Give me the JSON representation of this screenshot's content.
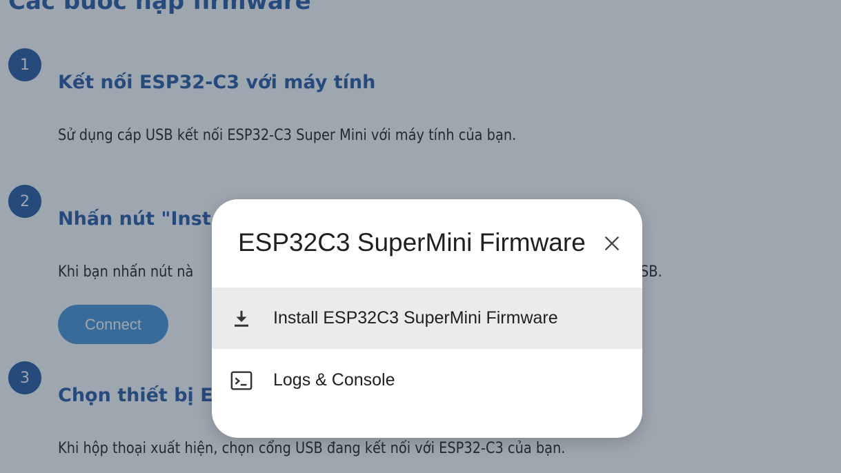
{
  "page": {
    "title": "Các bước nạp firmware",
    "steps": [
      {
        "number": "1",
        "title": "Kết nối ESP32-C3 với máy tính",
        "text": "Sử dụng cáp USB kết nối ESP32-C3 Super Mini với máy tính của bạn."
      },
      {
        "number": "2",
        "title_visible": "Nhấn nút \"Inst",
        "text_left_visible": "Khi bạn nhấn nút nà",
        "text_right_visible": "SB."
      },
      {
        "number": "3",
        "title_visible": "Chọn thiết bị E",
        "text": "Khi hộp thoại xuất hiện, chọn cổng USB đang kết nối với ESP32-C3 của bạn."
      }
    ],
    "connect_button": "Connect"
  },
  "dialog": {
    "title": "ESP32C3 SuperMini Firmware",
    "close_icon": "close-icon",
    "items": [
      {
        "icon": "download-icon",
        "label": "Install ESP32C3 SuperMini Firmware"
      },
      {
        "icon": "terminal-icon",
        "label": "Logs & Console"
      }
    ]
  },
  "colors": {
    "heading_blue": "#1b4fa0",
    "button_blue": "#3f8fd6",
    "overlay": "rgba(52,70,88,0.48)",
    "highlight_row": "#ebebeb"
  }
}
